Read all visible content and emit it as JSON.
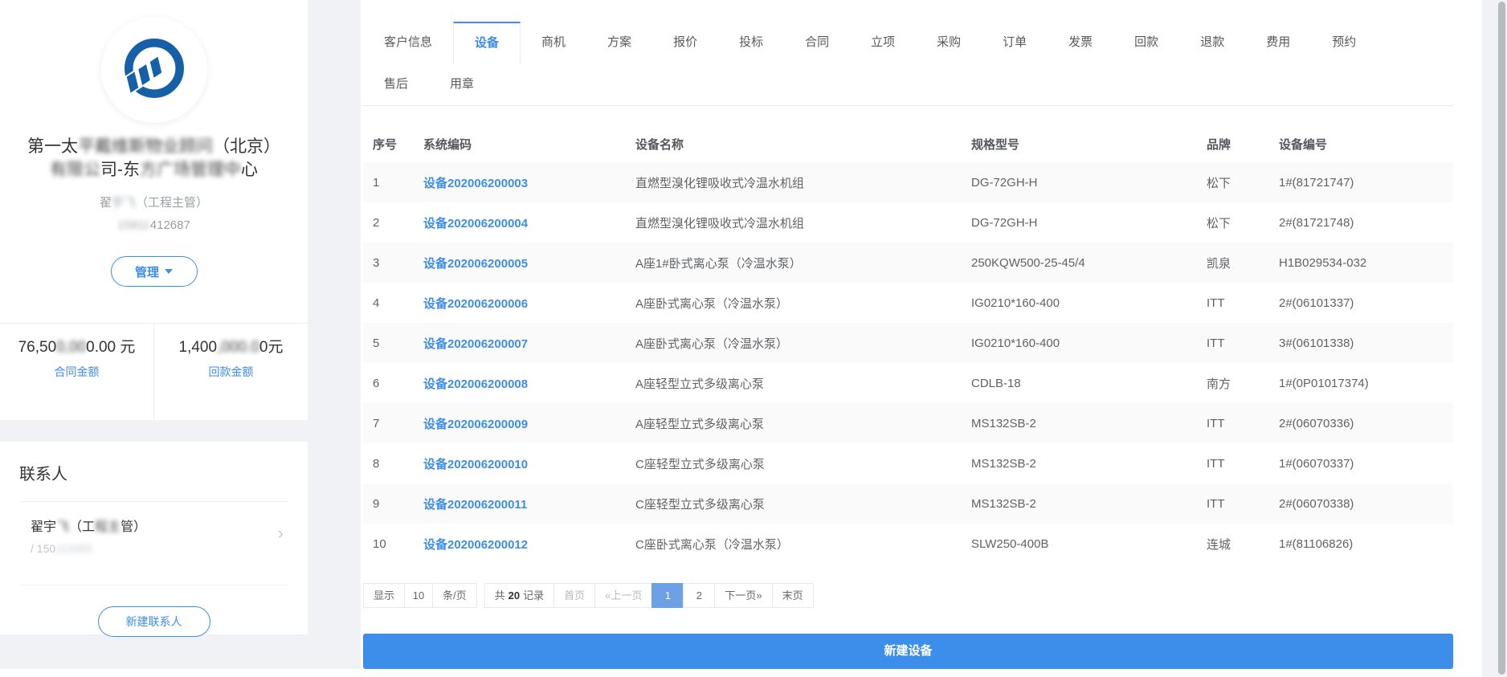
{
  "colors": {
    "accent": "#3D8DEB",
    "active_page_bg": "#6CA1E6",
    "logo_blue": "#1560A8",
    "row_stripe": "#fafafa"
  },
  "sidebar": {
    "logo_icon": "company-logo-blue-ring-emblem",
    "company_name_segments": [
      {
        "t": "第一太",
        "b": false
      },
      {
        "t": "平戴维斯物业顾问",
        "b": true
      },
      {
        "t": "（北京）",
        "b": false
      },
      {
        "t": "有限公",
        "b": true
      },
      {
        "t": "司-东",
        "b": false
      },
      {
        "t": "方广场管理中",
        "b": true
      },
      {
        "t": "心",
        "b": false
      }
    ],
    "owner_segments": [
      {
        "t": "翟",
        "b": false
      },
      {
        "t": "宇飞",
        "b": true
      },
      {
        "t": "（工程主管）",
        "b": false
      }
    ],
    "phone_segments": [
      {
        "t": "15811",
        "b": true
      },
      {
        "t": "412687",
        "b": false
      }
    ],
    "manage_button_label": "管理",
    "stats": [
      {
        "value_segments": [
          {
            "t": "76,50",
            "b": false
          },
          {
            "t": "0,00",
            "b": true
          },
          {
            "t": "0.00",
            "b": false
          },
          {
            "t": " 元",
            "b": false
          }
        ],
        "label": "合同金额"
      },
      {
        "value_segments": [
          {
            "t": "1,400",
            "b": false
          },
          {
            "t": ",000.0",
            "b": true
          },
          {
            "t": "0元",
            "b": false
          }
        ],
        "label": "回款金额"
      }
    ],
    "contacts": {
      "title": "联系人",
      "items": [
        {
          "name_segments": [
            {
              "t": "翟宇",
              "b": false
            },
            {
              "t": "飞",
              "b": true
            },
            {
              "t": "（工",
              "b": false
            },
            {
              "t": "程主",
              "b": true
            },
            {
              "t": "管）",
              "b": false
            }
          ],
          "phone_segments": [
            {
              "t": "/ 150",
              "b": false
            },
            {
              "t": "113355",
              "b": true
            }
          ]
        }
      ],
      "new_contact_button_label": "新建联系人"
    }
  },
  "tabs": {
    "row1": [
      "客户信息",
      "设备",
      "商机",
      "方案",
      "报价",
      "投标",
      "合同",
      "立项",
      "采购",
      "订单",
      "发票",
      "回款",
      "退款",
      "费用",
      "预约"
    ],
    "row2": [
      "售后",
      "用章"
    ],
    "active_tab": "设备"
  },
  "table": {
    "columns": [
      "序号",
      "系统编码",
      "设备名称",
      "规格型号",
      "品牌",
      "设备编号"
    ],
    "rows": [
      [
        "1",
        "设备202006200003",
        "直燃型溴化锂吸收式冷温水机组",
        "DG-72GH-H",
        "松下",
        "1#(81721747)"
      ],
      [
        "2",
        "设备202006200004",
        "直燃型溴化锂吸收式冷温水机组",
        "DG-72GH-H",
        "松下",
        "2#(81721748)"
      ],
      [
        "3",
        "设备202006200005",
        "A座1#卧式离心泵（冷温水泵）",
        "250KQW500-25-45/4",
        "凯泉",
        "H1B029534-032"
      ],
      [
        "4",
        "设备202006200006",
        "A座卧式离心泵（冷温水泵）",
        "IG0210*160-400",
        "ITT",
        "2#(06101337)"
      ],
      [
        "5",
        "设备202006200007",
        "A座卧式离心泵（冷温水泵）",
        "IG0210*160-400",
        "ITT",
        "3#(06101338)"
      ],
      [
        "6",
        "设备202006200008",
        "A座轻型立式多级离心泵",
        "CDLB-18",
        "南方",
        "1#(0P01017374)"
      ],
      [
        "7",
        "设备202006200009",
        "A座轻型立式多级离心泵",
        "MS132SB-2",
        "ITT",
        "2#(06070336)"
      ],
      [
        "8",
        "设备202006200010",
        "C座轻型立式多级离心泵",
        "MS132SB-2",
        "ITT",
        "1#(06070337)"
      ],
      [
        "9",
        "设备202006200011",
        "C座轻型立式多级离心泵",
        "MS132SB-2",
        "ITT",
        "2#(06070338)"
      ],
      [
        "10",
        "设备202006200012",
        "C座卧式离心泵（冷温水泵）",
        "SLW250-400B",
        "连城",
        "1#(81106826)"
      ]
    ]
  },
  "pagination": {
    "display_label": "显示",
    "page_size": "10",
    "per_page_label": "条/页",
    "total_prefix": "共",
    "total_count": "20",
    "total_suffix": "记录",
    "first_label": "首页",
    "prev_label": "«上一页",
    "pages": [
      "1",
      "2"
    ],
    "active_page": "1",
    "next_label": "下一页»",
    "last_label": "末页"
  },
  "new_device_button_label": "新建设备"
}
